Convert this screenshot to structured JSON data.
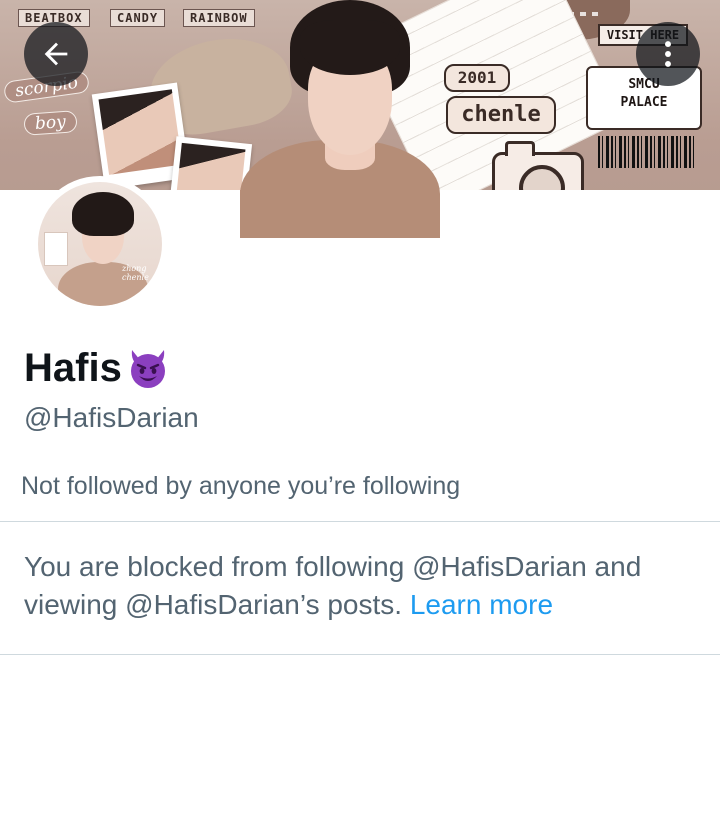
{
  "header": {
    "back_icon": "arrow-left-icon",
    "more_icon": "more-vertical-icon"
  },
  "banner": {
    "tags": [
      "BEATBOX",
      "CANDY",
      "RAINBOW"
    ],
    "script_tags": [
      "scorpio",
      "boy"
    ],
    "year_label": "2001",
    "name_label": "chenle",
    "visit_label": "VISIT HERE",
    "ticket_line1": "SMCU",
    "ticket_line2": "PALACE"
  },
  "avatar": {
    "overlay_text_line1": "zhong",
    "overlay_text_line2": "chenle"
  },
  "profile": {
    "display_name": "Hafis",
    "name_emoji": "smiling-devil-icon",
    "handle": "@HafisDarian",
    "followers_note": "Not followed by anyone you’re following"
  },
  "blocked": {
    "message": "You are blocked from following @HafisDarian and viewing @HafisDarian’s posts.",
    "learn_more": "Learn more"
  },
  "colors": {
    "text_primary": "#0f1419",
    "text_secondary": "#536471",
    "link": "#1d9bf0",
    "divider": "#cfd9de",
    "emoji_purple": "#8b3fbf"
  }
}
